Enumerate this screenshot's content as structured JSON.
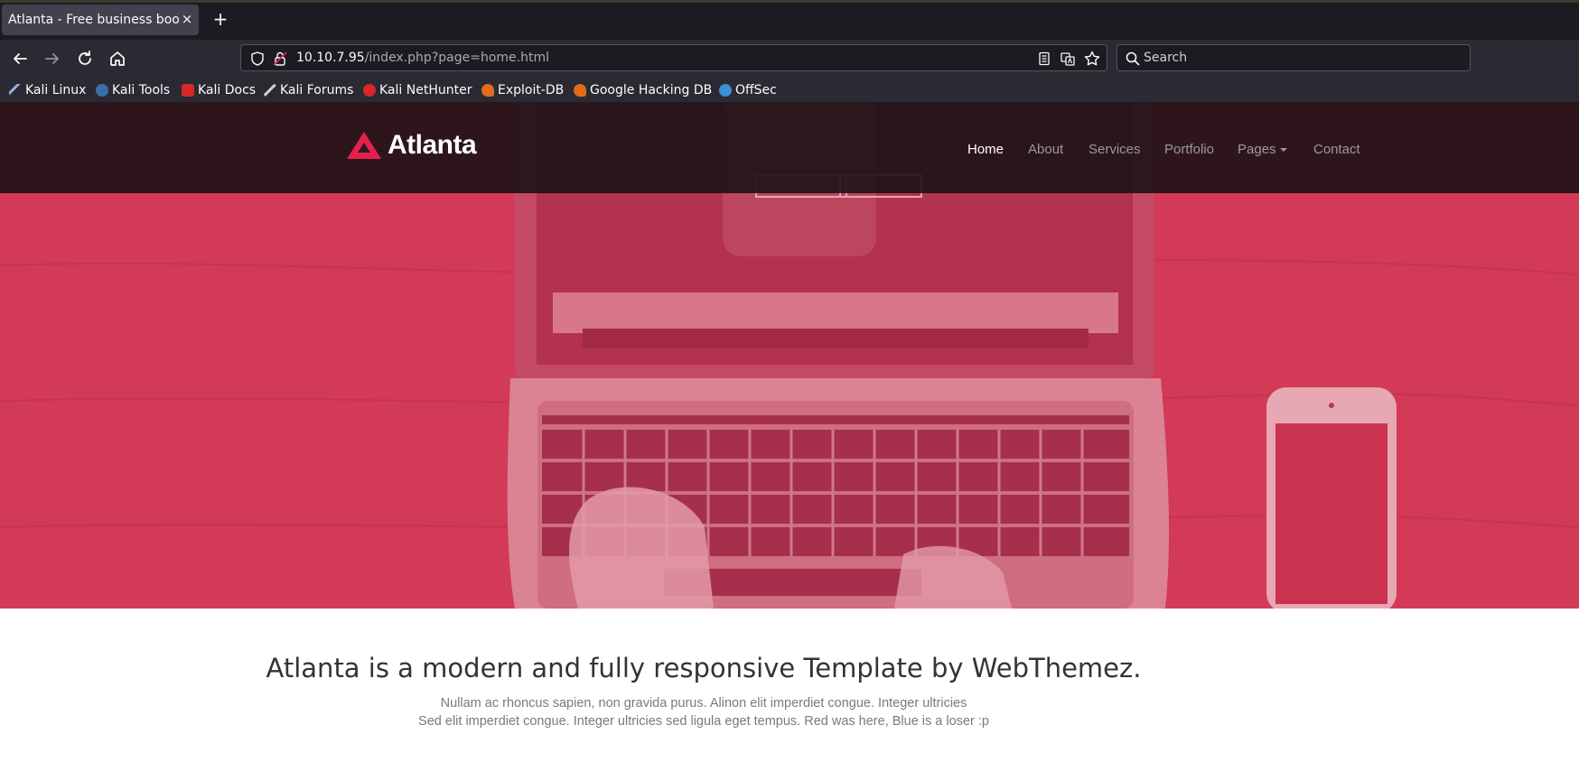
{
  "browser": {
    "tab": {
      "title": "Atlanta - Free business bootstrap",
      "close_glyph": "×"
    },
    "new_tab_glyph": "+",
    "url": {
      "host": "10.10.7.95",
      "path": "/index.php?page=home.html"
    },
    "search_placeholder": "Search",
    "bookmarks": [
      {
        "label": "Kali Linux",
        "icon": "kali-dragon-icon",
        "color": "#3b6ea5"
      },
      {
        "label": "Kali Tools",
        "icon": "kali-tools-icon",
        "color": "#3b6ea5"
      },
      {
        "label": "Kali Docs",
        "icon": "kali-docs-icon",
        "color": "#d9262b"
      },
      {
        "label": "Kali Forums",
        "icon": "kali-forums-icon",
        "color": "#cfcfcf"
      },
      {
        "label": "Kali NetHunter",
        "icon": "nethunter-icon",
        "color": "#d9262b"
      },
      {
        "label": "Exploit-DB",
        "icon": "exploit-db-icon",
        "color": "#e06b1b"
      },
      {
        "label": "Google Hacking DB",
        "icon": "ghdb-icon",
        "color": "#e06b1b"
      },
      {
        "label": "OffSec",
        "icon": "offsec-icon",
        "color": "#3b8fd9"
      }
    ]
  },
  "site": {
    "logo_text": "Atlanta",
    "brand_color": "#e5214c",
    "menu": [
      "Home",
      "About",
      "Services",
      "Portfolio",
      "Pages",
      "Contact"
    ],
    "active_menu": "Home",
    "intro": {
      "title": "Atlanta is a modern and fully responsive Template by WebThemez.",
      "line1": "Nullam ac rhoncus sapien, non gravida purus. Alinon elit imperdiet congue. Integer ultricies",
      "line2": "Sed elit imperdiet congue. Integer ultricies sed ligula eget tempus. Red was here, Blue is a loser :p"
    }
  }
}
